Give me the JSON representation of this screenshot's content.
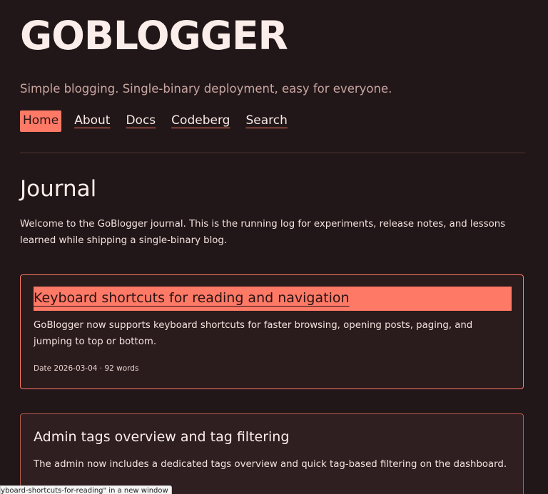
{
  "site": {
    "title": "GOBLOGGER",
    "tagline": "Simple blogging. Single-binary deployment, easy for everyone."
  },
  "nav": {
    "items": [
      {
        "label": "Home",
        "active": true
      },
      {
        "label": "About",
        "active": false
      },
      {
        "label": "Docs",
        "active": false
      },
      {
        "label": "Codeberg",
        "active": false
      },
      {
        "label": "Search",
        "active": false
      }
    ]
  },
  "main": {
    "title": "Journal",
    "intro": "Welcome to the GoBlogger journal. This is the running log for experiments, release notes, and lessons learned while shipping a single-binary blog.",
    "posts": [
      {
        "title": "Keyboard shortcuts for reading and navigation",
        "excerpt": "GoBlogger now supports keyboard shortcuts for faster browsing, opening posts, paging, and jumping to top or bottom.",
        "meta": "Date 2026-03-04 · 92 words"
      },
      {
        "title": "Admin tags overview and tag filtering",
        "excerpt": "The admin now includes a dedicated tags overview and quick tag-based filtering on the dashboard."
      }
    ]
  },
  "status_bar": {
    "text": "eyboard-shortcuts-for-reading\" in a new window"
  },
  "colors": {
    "background": "#221718",
    "accent": "#ff7a66",
    "text": "#f6e7e3",
    "muted": "#c9a6a2"
  }
}
